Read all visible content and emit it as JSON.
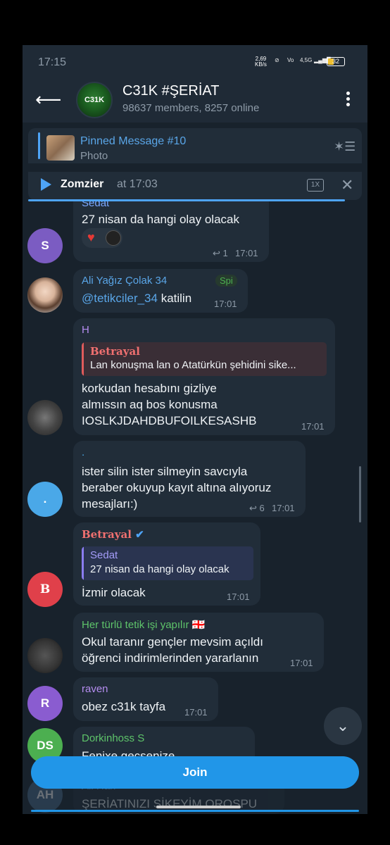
{
  "status": {
    "time": "17:15",
    "speed_top": "2,69",
    "speed_unit": "KB/s",
    "net": "4,5G",
    "battery": "32",
    "battery_color": "#f0c030"
  },
  "header": {
    "back_icon": "arrow-left-icon",
    "avatar_text": "C31K",
    "title": "C31K #ŞERİAT",
    "subtitle": "98637 members, 8257 online"
  },
  "pinned": {
    "title": "Pinned Message #10",
    "text": "Photo"
  },
  "audio": {
    "name": "Zomzier",
    "time": "at 17:03",
    "speed": "1X",
    "progress": 0.95
  },
  "messages": [
    {
      "name": "Sedat",
      "text": "27 nisan da hangi olay olacak",
      "replies": "1",
      "time": "17:01",
      "avatar": "S",
      "avatar_color": "#7b5cc2",
      "reactions": [
        "red-heart",
        "emoji"
      ]
    },
    {
      "name": "Ali Yağız Çolak 34",
      "badge": "Spi",
      "link": "@tetikciler_34",
      "text": " katilin",
      "time": "17:01"
    },
    {
      "name": "H",
      "quote_name": "Betrayal",
      "quote_text": "Lan konuşma lan o Atatürkün şehidini sike...",
      "lines": [
        "korkudan hesabını gizliye",
        "almıssın aq bos konusma",
        "IOSLKJDAHDBUFOILKESASHB"
      ],
      "time": "17:01"
    },
    {
      "name": ".",
      "lines": [
        "ister silin ister silmeyin savcıyla",
        "beraber okuyup kayıt altına alıyoruz",
        "mesajları:)"
      ],
      "replies": "6",
      "time": "17:01",
      "avatar": ".",
      "avatar_color": "#4aa8e8"
    },
    {
      "name": "Betrayal",
      "quote_name": "Sedat",
      "quote_text": "27 nisan da hangi olay olacak",
      "text": "İzmir olacak",
      "time": "17:01",
      "avatar": "B",
      "avatar_color": "#e0404a"
    },
    {
      "name": "Her türlü tetik işi yapılır 🇬🇪",
      "lines": [
        "Okul taranır gençler mevsim açıldı",
        "öğrenci indirimlerinden yararlanın"
      ],
      "time": "17:01"
    },
    {
      "name": "raven",
      "text": "obez c31k tayfa",
      "time": "17:01",
      "avatar": "R",
      "avatar_color": "#8a5cd0"
    },
    {
      "name": "Dorkinhoss S",
      "text": "Fenixe gecsenize",
      "avatar": "DS",
      "avatar_color": "#4caf50"
    },
    {
      "name": "Ali Han",
      "text": "ŞERİATINIZI SİKEYİM OROSPU",
      "avatar": "AH",
      "avatar_color": "#4a6a8a"
    }
  ],
  "join_label": "Join"
}
